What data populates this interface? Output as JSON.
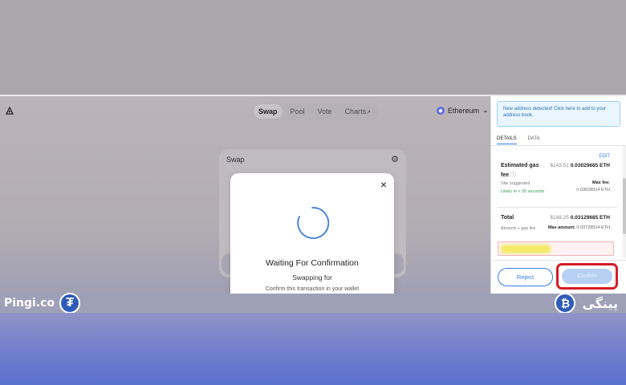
{
  "app": {
    "nav_tabs": [
      {
        "label": "Swap",
        "active": true
      },
      {
        "label": "Pool",
        "active": false
      },
      {
        "label": "Vote",
        "active": false
      },
      {
        "label": "Charts",
        "active": false,
        "suffix": "↗"
      }
    ],
    "network": "Ethereum",
    "network_chevron": "⌄",
    "swap_title": "Swap"
  },
  "modal": {
    "title": "Waiting For Confirmation",
    "subtitle": "Swapping for",
    "note": "Confirm this transaction in your wallet",
    "close": "×"
  },
  "wallet": {
    "notice": "New address detected! Click here to add to your address book.",
    "tabs": [
      "DETAILS",
      "DATA"
    ],
    "edit": "EDIT",
    "gas_label_1": "Estimated gas",
    "gas_label_2": "fee",
    "gas_usd": "$143.51",
    "gas_eth": "0.03029685 ETH",
    "site_suggested": "Site suggested",
    "likely": "Likely in < 30 seconds",
    "max_fee_label": "Max fee:",
    "max_fee_value": "0.03628914 ETH",
    "total_label": "Total",
    "total_usd": "$148.25",
    "total_eth": "0.03129685 ETH",
    "amount_gas": "Amount + gas fee",
    "max_amount_label": "Max amount:",
    "max_amount_value": "0.03728914 ETH",
    "reject": "Reject",
    "confirm": "Confirm"
  },
  "branding": {
    "left_text": "Pingi.co",
    "left_coin": "₮",
    "right_text": "پینگی",
    "right_coin": "₿"
  },
  "colors": {
    "accent_blue": "#2f80ed",
    "highlight_red": "#d51c26",
    "success_green": "#3a9b57"
  }
}
